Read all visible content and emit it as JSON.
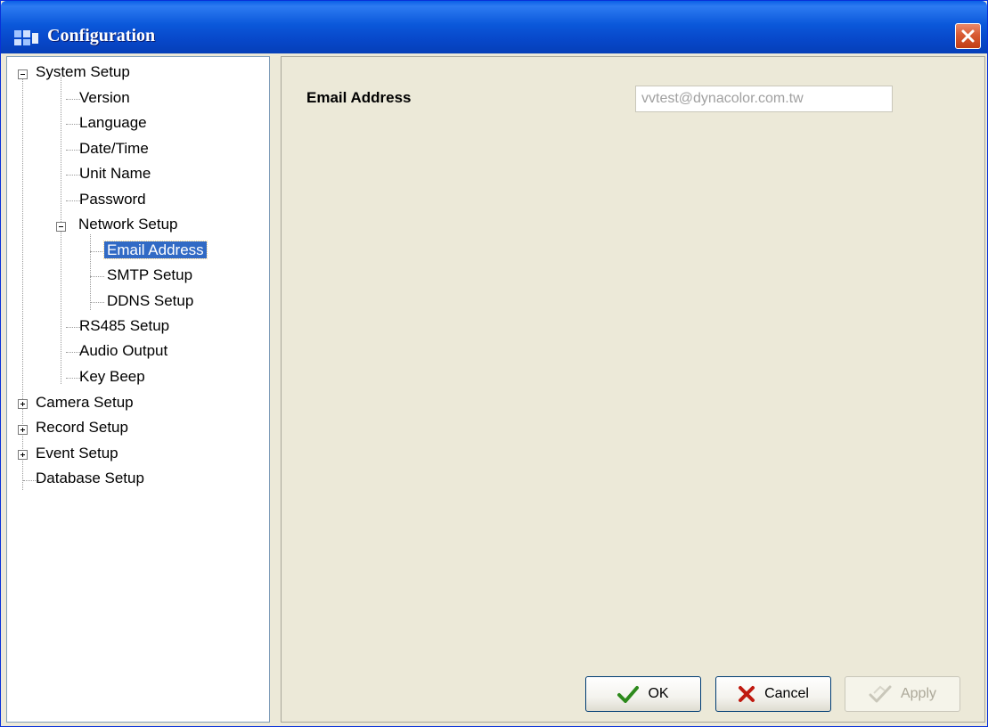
{
  "window": {
    "title": "Configuration"
  },
  "tree": {
    "items": [
      {
        "label": "System Setup"
      },
      {
        "label": "Version"
      },
      {
        "label": "Language"
      },
      {
        "label": "Date/Time"
      },
      {
        "label": "Unit Name"
      },
      {
        "label": "Password"
      },
      {
        "label": "Network Setup"
      },
      {
        "label": "Email Address",
        "selected": true
      },
      {
        "label": "SMTP Setup"
      },
      {
        "label": "DDNS Setup"
      },
      {
        "label": "RS485 Setup"
      },
      {
        "label": "Audio Output"
      },
      {
        "label": "Key Beep"
      },
      {
        "label": "Camera Setup"
      },
      {
        "label": "Record Setup"
      },
      {
        "label": "Event Setup"
      },
      {
        "label": "Database Setup"
      }
    ]
  },
  "content": {
    "email_label": "Email Address",
    "email_value": "vvtest@dynacolor.com.tw"
  },
  "buttons": {
    "ok": "OK",
    "cancel": "Cancel",
    "apply": "Apply"
  },
  "colors": {
    "titlebar": "#0b58da",
    "selection": "#316ac5",
    "close": "#d85a33"
  }
}
